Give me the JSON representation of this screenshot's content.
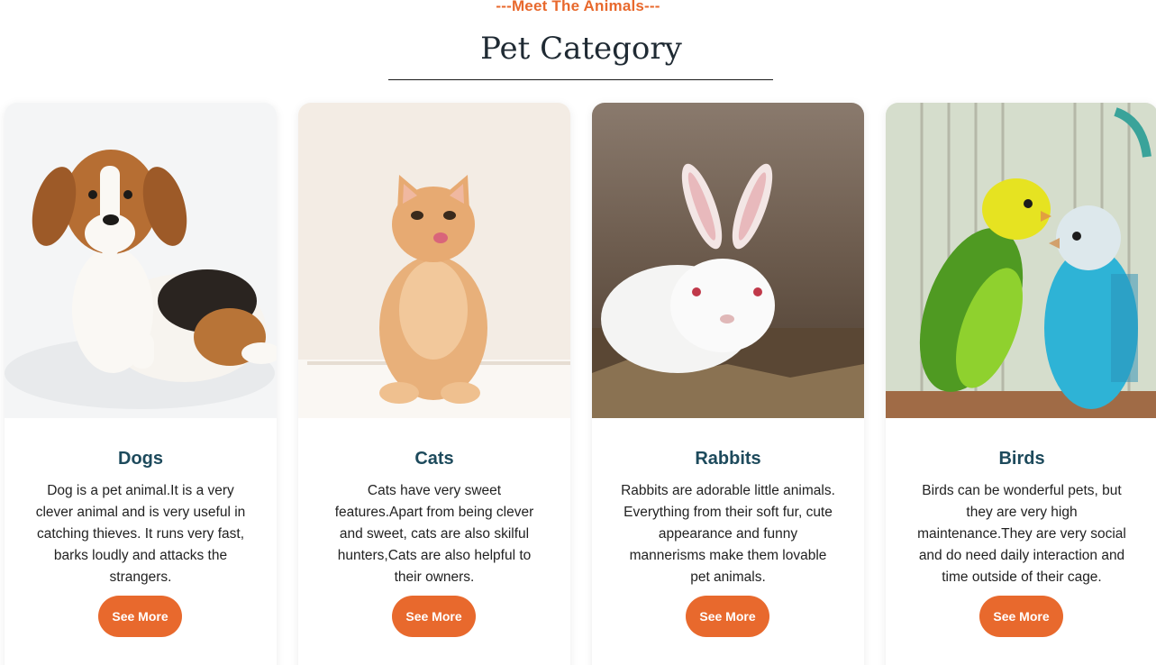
{
  "header": {
    "eyebrow": "---Meet The Animals---",
    "title": "Pet Category"
  },
  "accent_color": "#e8692d",
  "heading_color": "#1d4a5c",
  "cards": [
    {
      "name": "Dogs",
      "image_icon": "beagle-photo",
      "description": "Dog is a pet animal.It is a very clever animal and is very useful in catching thieves. It runs very fast, barks loudly and attacks the strangers.",
      "button_label": "See More"
    },
    {
      "name": "Cats",
      "image_icon": "kitten-photo",
      "description": "Cats have very sweet features.Apart from being clever and sweet, cats are also skilful hunters,Cats are also helpful to their owners.",
      "button_label": "See More"
    },
    {
      "name": "Rabbits",
      "image_icon": "rabbit-photo",
      "description": "Rabbits are adorable little animals. Everything from their soft fur, cute appearance and funny mannerisms make them lovable pet animals.",
      "button_label": "See More"
    },
    {
      "name": "Birds",
      "image_icon": "budgies-photo",
      "description": "Birds can be wonderful pets, but they are very high maintenance.They are very social and do need daily interaction and time outside of their cage.",
      "button_label": "See More"
    }
  ]
}
